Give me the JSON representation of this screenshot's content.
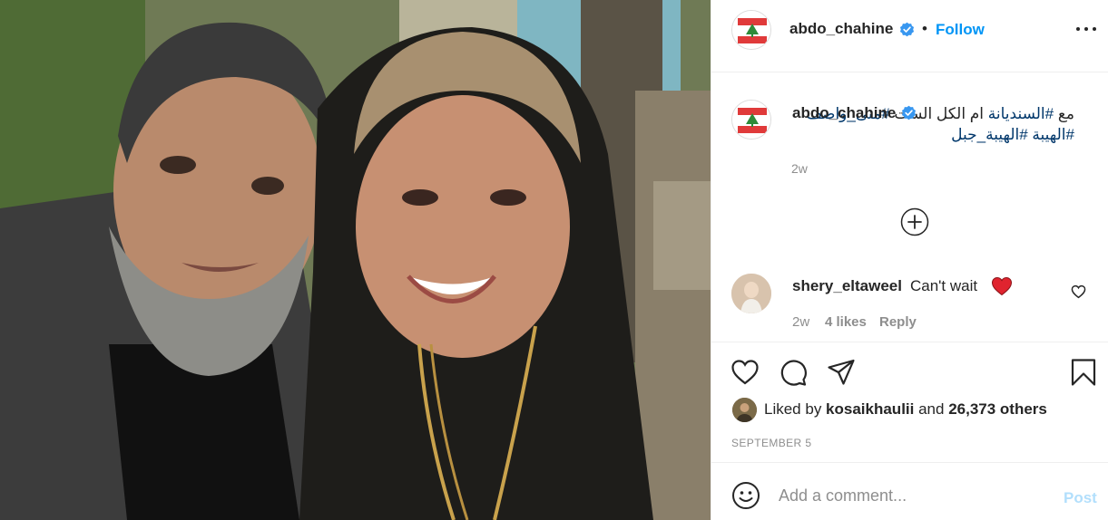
{
  "post": {
    "author": "abdo_chahine",
    "follow_label": "Follow",
    "separator": "•",
    "caption_author": "abdo_chahine",
    "caption_lead": "مع ",
    "caption_tag1": "#السنديانة",
    "caption_mid": " ام الكل الست ",
    "caption_tag2": "#منى_واصف",
    "caption_tag3": "#الهيبة",
    "caption_tag4": "#الهيبة_جبل",
    "caption_time": "2w"
  },
  "comments": [
    {
      "user": "shery_eltaweel",
      "text": "Can't wait",
      "time": "2w",
      "likes": "4 likes",
      "reply_label": "Reply"
    }
  ],
  "likes": {
    "prefix": "Liked by ",
    "user": "kosaikhaulii",
    "middle": " and ",
    "others": "26,373 others"
  },
  "date": "SEPTEMBER 5",
  "composer": {
    "placeholder": "Add a comment...",
    "post_label": "Post"
  },
  "colors": {
    "accent": "#0095f6",
    "post_disabled": "#b2dffc",
    "heart_red": "#ed4956",
    "verified": "#3897f0"
  },
  "icons": [
    "more-options-icon",
    "verified-badge-icon",
    "load-more-icon",
    "heart-icon",
    "comment-icon",
    "share-icon",
    "bookmark-icon",
    "emoji-icon"
  ]
}
